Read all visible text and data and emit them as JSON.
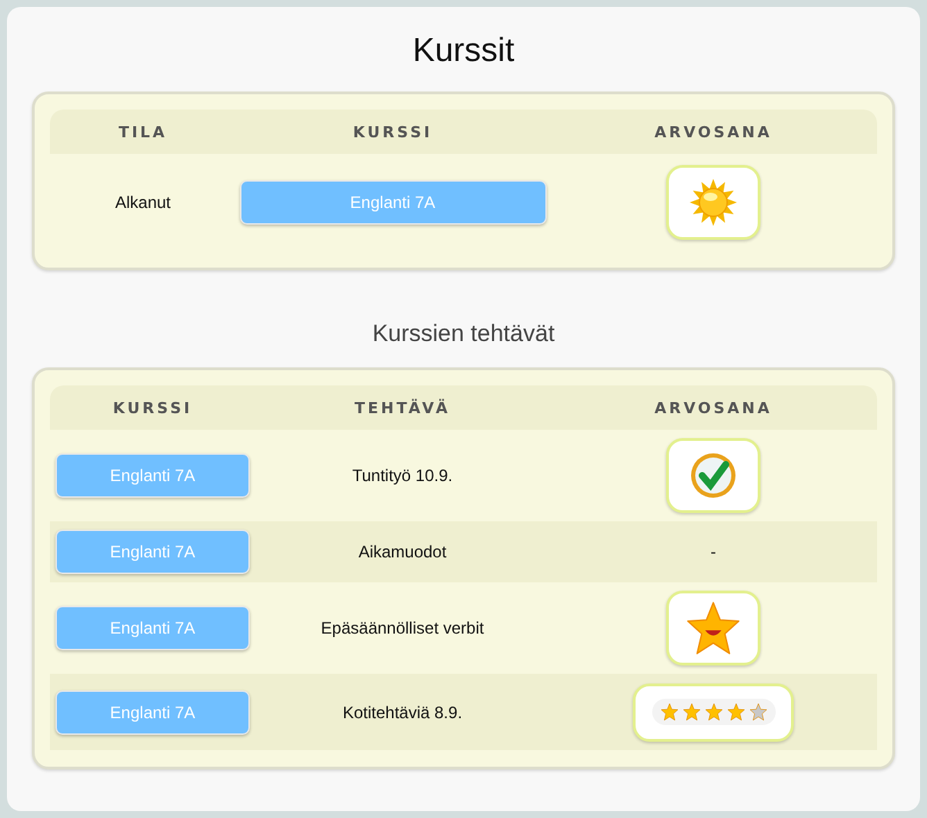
{
  "title": "Kurssit",
  "courses": {
    "columns": [
      "TILA",
      "KURSSI",
      "ARVOSANA"
    ],
    "rows": [
      {
        "status": "Alkanut",
        "course": "Englanti 7A",
        "grade": {
          "kind": "sun"
        }
      }
    ]
  },
  "tasks_title": "Kurssien tehtävät",
  "tasks": {
    "columns": [
      "KURSSI",
      "TEHTÄVÄ",
      "ARVOSANA"
    ],
    "rows": [
      {
        "course": "Englanti 7A",
        "task": "Tuntityö 10.9.",
        "grade": {
          "kind": "check"
        }
      },
      {
        "course": "Englanti 7A",
        "task": "Aikamuodot",
        "grade": {
          "kind": "text",
          "text": "-"
        }
      },
      {
        "course": "Englanti 7A",
        "task": "Epäsäännölliset verbit",
        "grade": {
          "kind": "star"
        }
      },
      {
        "course": "Englanti 7A",
        "task": "Kotitehtäviä 8.9.",
        "grade": {
          "kind": "stars",
          "stars": 4
        }
      }
    ]
  }
}
